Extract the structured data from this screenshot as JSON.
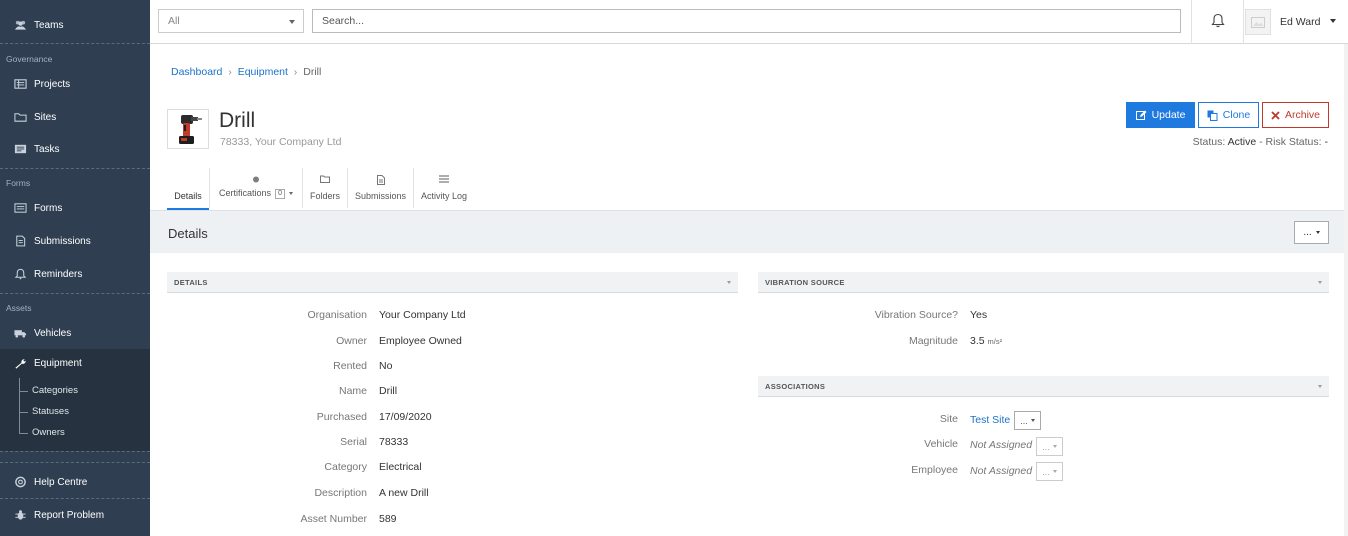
{
  "sidebar": {
    "teams": "Teams",
    "section_governance": "Governance",
    "projects": "Projects",
    "sites": "Sites",
    "tasks": "Tasks",
    "section_forms": "Forms",
    "forms": "Forms",
    "submissions": "Submissions",
    "reminders": "Reminders",
    "section_assets": "Assets",
    "vehicles": "Vehicles",
    "equipment": "Equipment",
    "sub_categories": "Categories",
    "sub_statuses": "Statuses",
    "sub_owners": "Owners",
    "help_centre": "Help Centre",
    "report_problem": "Report Problem"
  },
  "topbar": {
    "filter_value": "All",
    "search_placeholder": "Search...",
    "user_name": "Ed Ward"
  },
  "breadcrumb": {
    "items": [
      "Dashboard",
      "Equipment",
      "Drill"
    ]
  },
  "header": {
    "title": "Drill",
    "subtitle": "78333, Your Company Ltd",
    "update_label": "Update",
    "clone_label": "Clone",
    "archive_label": "Archive",
    "status_label": "Status:",
    "status_value": "Active",
    "sep": "-",
    "risk_label": "Risk Status:",
    "risk_value": "-"
  },
  "tabs": {
    "details": "Details",
    "certifications": "Certifications",
    "certifications_count": "0",
    "folders": "Folders",
    "submissions": "Submissions",
    "activity_log": "Activity Log"
  },
  "band": {
    "title": "Details",
    "more": "..."
  },
  "details_panel": {
    "heading": "DETAILS",
    "fields": [
      {
        "label": "Organisation",
        "value": "Your Company Ltd"
      },
      {
        "label": "Owner",
        "value": "Employee Owned"
      },
      {
        "label": "Rented",
        "value": "No"
      },
      {
        "label": "Name",
        "value": "Drill"
      },
      {
        "label": "Purchased",
        "value": "17/09/2020"
      },
      {
        "label": "Serial",
        "value": "78333"
      },
      {
        "label": "Category",
        "value": "Electrical"
      },
      {
        "label": "Description",
        "value": "A new Drill"
      },
      {
        "label": "Asset Number",
        "value": "589"
      }
    ]
  },
  "vibration_panel": {
    "heading": "VIBRATION SOURCE",
    "source_label": "Vibration Source?",
    "source_value": "Yes",
    "magnitude_label": "Magnitude",
    "magnitude_value": "3.5",
    "magnitude_unit": "m/s²"
  },
  "associations_panel": {
    "heading": "ASSOCIATIONS",
    "site_label": "Site",
    "site_value": "Test Site",
    "vehicle_label": "Vehicle",
    "vehicle_value": "Not Assigned",
    "employee_label": "Employee",
    "employee_value": "Not Assigned",
    "more": "..."
  },
  "colors": {
    "sidebar_bg": "#2f3f51",
    "primary": "#1f7ae0",
    "danger": "#c0392b",
    "link": "#1a73c8"
  },
  "icons": [
    "users-icon",
    "projects-icon",
    "folder-icon",
    "tasks-icon",
    "forms-icon",
    "document-icon",
    "bell-icon",
    "truck-icon",
    "wrench-icon",
    "lifebuoy-icon",
    "bug-icon",
    "pencil-icon",
    "copy-icon",
    "close-icon",
    "image-icon"
  ]
}
